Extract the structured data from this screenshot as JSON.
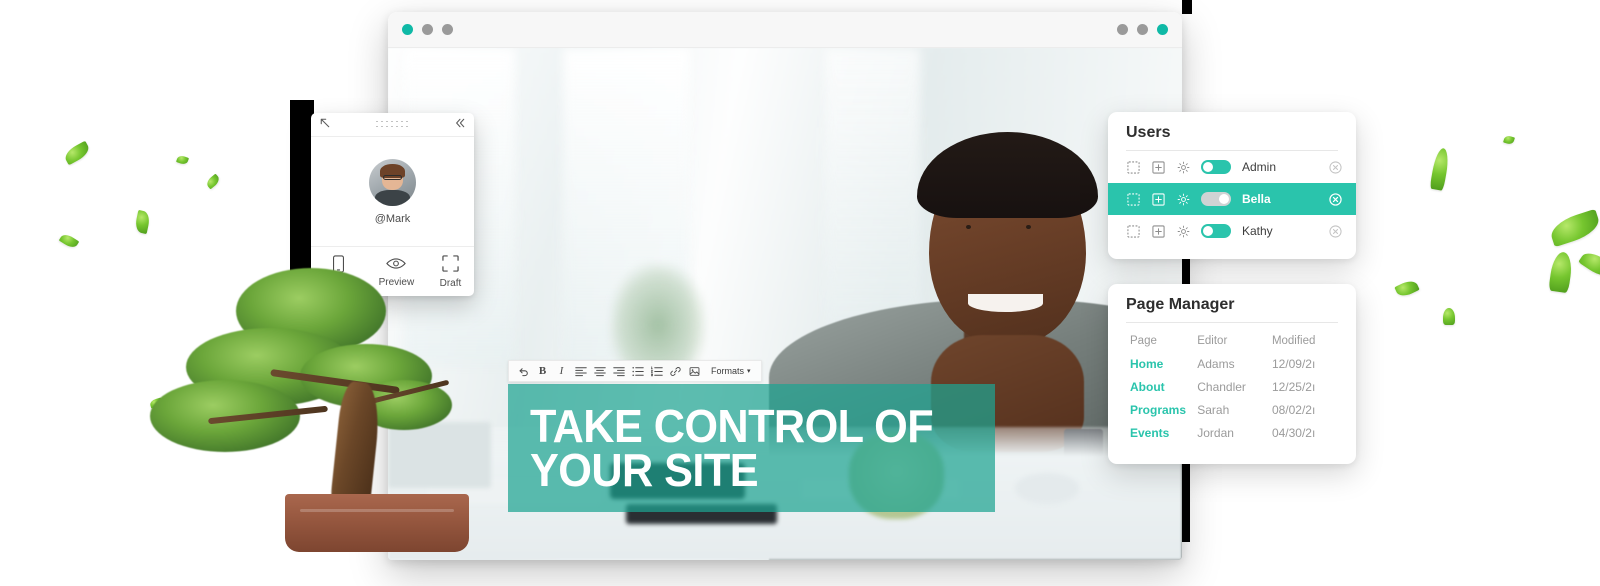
{
  "browser": {
    "window_dots_left": [
      "teal",
      "grey",
      "grey"
    ],
    "window_dots_right": [
      "grey",
      "grey",
      "teal"
    ]
  },
  "hero": {
    "headline_line1": "TAKE CONTROL OF",
    "headline_line2": "YOUR SITE",
    "overlay_color": "#1fa392"
  },
  "editor_toolbar": {
    "items": [
      {
        "name": "undo-icon",
        "label": "Undo"
      },
      {
        "name": "bold-icon",
        "label": "B"
      },
      {
        "name": "italic-icon",
        "label": "I"
      },
      {
        "name": "align-left-icon",
        "label": "Align left"
      },
      {
        "name": "align-center-icon",
        "label": "Align center"
      },
      {
        "name": "align-right-icon",
        "label": "Align right"
      },
      {
        "name": "bullet-list-icon",
        "label": "Bulleted list"
      },
      {
        "name": "numbered-list-icon",
        "label": "Numbered list"
      },
      {
        "name": "link-icon",
        "label": "Insert link"
      },
      {
        "name": "image-icon",
        "label": "Insert image"
      }
    ],
    "formats_label": "Formats",
    "formats_caret": "▾"
  },
  "user_panel": {
    "collapse_icon": "arrow-up-left-icon",
    "drag_handle_icon": "drag-dots-icon",
    "minimize_icon": "chevron-double-left-icon",
    "handle": "@Mark",
    "actions": [
      {
        "icon": "mobile-icon",
        "label": "Mobile"
      },
      {
        "icon": "eye-icon",
        "label": "Preview"
      },
      {
        "icon": "draft-icon",
        "label": "Draft"
      }
    ]
  },
  "users_card": {
    "title": "Users",
    "row_icons": [
      "dashed-square-icon",
      "add-square-icon",
      "gear-icon"
    ],
    "close_icon": "circle-x-icon",
    "rows": [
      {
        "name": "Admin",
        "toggle_on": true,
        "selected": false
      },
      {
        "name": "Bella",
        "toggle_on": false,
        "selected": true
      },
      {
        "name": "Kathy",
        "toggle_on": true,
        "selected": false
      }
    ],
    "accent_color": "#2ac4ac"
  },
  "page_manager": {
    "title": "Page Manager",
    "columns": [
      "Page",
      "Editor",
      "Modified"
    ],
    "rows": [
      {
        "page": "Home",
        "editor": "Adams",
        "modified": "12/09/2ı"
      },
      {
        "page": "About",
        "editor": "Chandler",
        "modified": "12/25/2ı"
      },
      {
        "page": "Programs",
        "editor": "Sarah",
        "modified": "08/02/2ı"
      },
      {
        "page": "Events",
        "editor": "Jordan",
        "modified": "04/30/2ı"
      }
    ],
    "link_color": "#2ac4ac"
  },
  "decoration": {
    "bonsai": "bonsai-tree",
    "leaves_count": 12
  }
}
